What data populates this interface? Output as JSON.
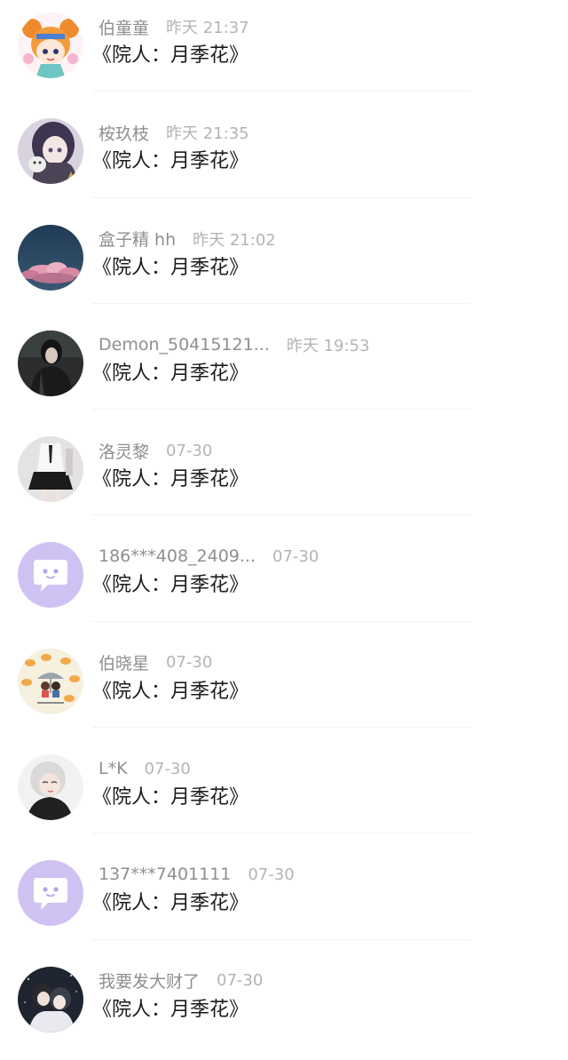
{
  "comments": [
    {
      "name": "伯童童",
      "time": "昨天 21:37",
      "text": "《院人：月季花》",
      "avatar_icon": "anime-girl-orange-hair-avatar-icon"
    },
    {
      "name": "桉玖枝",
      "time": "昨天 21:35",
      "text": "《院人：月季花》",
      "avatar_icon": "anime-girl-with-cat-avatar-icon"
    },
    {
      "name": "盒子精 hh",
      "time": "昨天 21:02",
      "text": "《院人：月季花》",
      "avatar_icon": "pink-clouds-sky-avatar-icon"
    },
    {
      "name": "Demon_50415121...",
      "time": "昨天 19:53",
      "text": "《院人：月季花》",
      "avatar_icon": "dark-photo-person-avatar-icon"
    },
    {
      "name": "洛灵黎",
      "time": "07-30",
      "text": "《院人：月季花》",
      "avatar_icon": "girl-school-uniform-avatar-icon"
    },
    {
      "name": "186***408_2409...",
      "time": "07-30",
      "text": "《院人：月季花》",
      "avatar_icon": "default-chat-bubble-avatar-icon"
    },
    {
      "name": "伯晓星",
      "time": "07-30",
      "text": "《院人：月季花》",
      "avatar_icon": "cartoon-couple-umbrella-avatar-icon"
    },
    {
      "name": "L*K",
      "time": "07-30",
      "text": "《院人：月季花》",
      "avatar_icon": "anime-boy-white-hair-avatar-icon"
    },
    {
      "name": "137***7401111",
      "time": "07-30",
      "text": "《院人：月季花》",
      "avatar_icon": "default-chat-bubble-avatar-icon"
    },
    {
      "name": "我要发大财了",
      "time": "07-30",
      "text": "《院人：月季花》",
      "avatar_icon": "anime-couple-dark-avatar-icon"
    }
  ],
  "colors": {
    "name": "#8e8e93",
    "time": "#b4b4b8",
    "comment_text": "#1c1c1e",
    "default_avatar": "#cfc2f3",
    "divider": "#f2f2f4"
  }
}
